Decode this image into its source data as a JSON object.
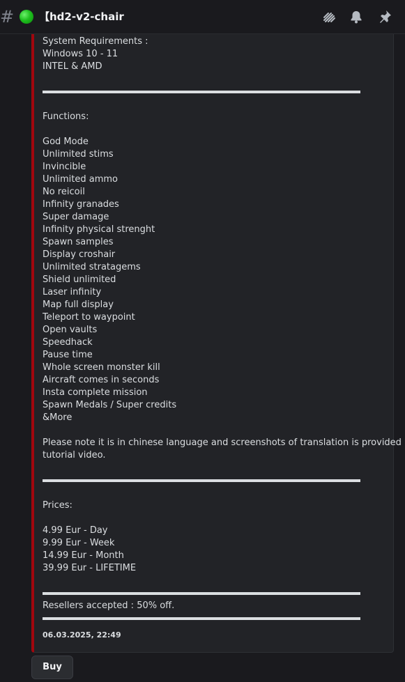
{
  "header": {
    "hash": "#",
    "channel_name": "【hd2-v2-chair",
    "icons": [
      "threads-icon",
      "bell-icon",
      "pin-icon"
    ]
  },
  "embed": {
    "accent_color": "#a1070e",
    "requirements": [
      "System Requirements :",
      "Windows 10 - 11",
      "INTEL & AMD"
    ],
    "functions_title": "Functions:",
    "functions": [
      "God Mode",
      "Unlimited stims",
      "Invincible",
      "Unlimited ammo",
      "No reicoil",
      "Infinity granades",
      "Super damage",
      "Infinity physical strenght",
      "Spawn samples",
      "Display croshair",
      "Unlimited stratagems",
      "Shield unlimited",
      "Laser infinity",
      "Map full display",
      "Teleport to waypoint",
      "Open vaults",
      "Speedhack",
      "Pause time",
      "Whole screen monster kill",
      "Aircraft comes in seconds",
      "Insta complete mission",
      "Spawn Medals / Super credits",
      "&More"
    ],
    "note_line1": "Please note it is in chinese language and screenshots of translation is provided +",
    "note_line2": "tutorial video.",
    "prices_title": "Prices:",
    "prices": [
      "4.99 Eur - Day",
      "9.99 Eur - Week",
      "14.99 Eur - Month",
      "39.99 Eur - LIFETIME"
    ],
    "resellers": "Resellers accepted : 50% off.",
    "timestamp": "06.03.2025, 22:49"
  },
  "buy_button": "Buy"
}
